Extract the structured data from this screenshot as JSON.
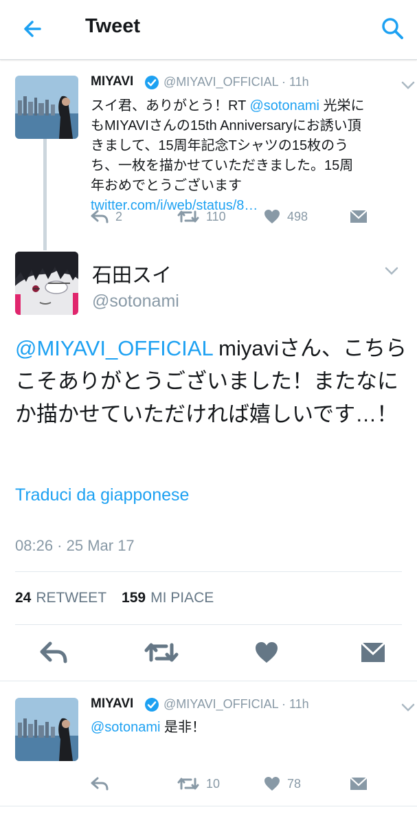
{
  "header": {
    "title": "Tweet"
  },
  "parent_tweet": {
    "name": "MIYAVI",
    "handle": "@MIYAVI_OFFICIAL",
    "time": "· 11h",
    "text_before": "スイ君、ありがとう！RT ",
    "mention": "@sotonami",
    "text_middle": " 光栄にもMIYAVIさんの15th Anniversaryにお誘い頂きまして、15周年記念Tシャツの15枚のうち、一枚を描かせていただきました。15周年おめでとうございます",
    "url": "twitter.com/i/web/status/8…",
    "replies": "2",
    "retweets": "110",
    "likes": "498"
  },
  "main_tweet": {
    "name": "石田スイ",
    "handle": "@sotonami",
    "mention": "@MIYAVI_OFFICIAL",
    "text": " miyaviさん、こちらこそありがとうございました！またなにか描かせていただければ嬉しいです…！",
    "translate": "Traduci da giapponese",
    "timestamp": "08:26 · 25 Mar 17",
    "retweet_count": "24",
    "retweet_label": "RETWEET",
    "like_count": "159",
    "like_label": "MI PIACE"
  },
  "reply_tweet": {
    "name": "MIYAVI",
    "handle": "@MIYAVI_OFFICIAL",
    "time": "· 11h",
    "mention": "@sotonami",
    "text": " 是非！",
    "retweets": "10",
    "likes": "78"
  },
  "colors": {
    "accent": "#1da1f2",
    "muted": "#8899a6",
    "verified": "#1da1f2"
  }
}
